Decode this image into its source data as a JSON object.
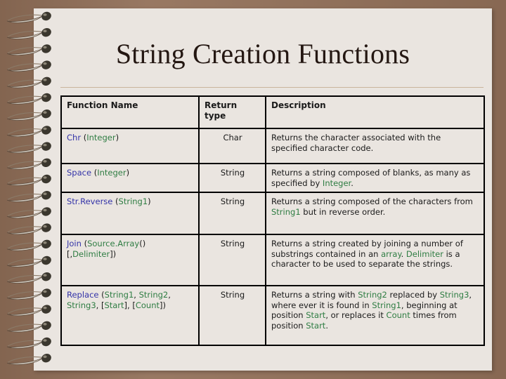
{
  "slide": {
    "title": "String Creation Functions",
    "theme": {
      "page_background": "#eae5e0",
      "surround_background": "#927059",
      "rule_color": "#c9b59c",
      "function_name_color": "#3333a8",
      "parameter_color": "#2f7d43",
      "text_color": "#1a1a1a",
      "table_border_color": "#000000"
    }
  },
  "table": {
    "headers": {
      "function_name": "Function Name",
      "return_type": "Return type",
      "description": "Description"
    },
    "rows": [
      {
        "function": "Chr",
        "params": " (Integer)",
        "return_type": "Char",
        "description": "Returns the character associated with the specified character code."
      },
      {
        "function": "Space",
        "params": " (Integer)",
        "return_type": "String",
        "description": "Returns a string composed of blanks, as many as specified by Integer."
      },
      {
        "function": "Str.Reverse",
        "params": " (String1)",
        "return_type": "String",
        "description": "Returns a string composed of the characters from String1 but in reverse order."
      },
      {
        "function": "Join",
        "params": " (Source.Array() [,Delimiter])",
        "return_type": "String",
        "description": "Returns a string created by joining a number of substrings contained in an array. Delimiter is a character to be used to separate the strings."
      },
      {
        "function": "Replace",
        "params": " (String1, String2, String3, [Start], [Count])",
        "return_type": "String",
        "description": "Returns a string with String2 replaced by String3, where ever it is found in String1, beginning at position Start, or replaces it Count times from position Start."
      }
    ]
  },
  "decor": {
    "spiral_ring_count": 22,
    "spiral_icon": "spiral-ring-icon"
  }
}
